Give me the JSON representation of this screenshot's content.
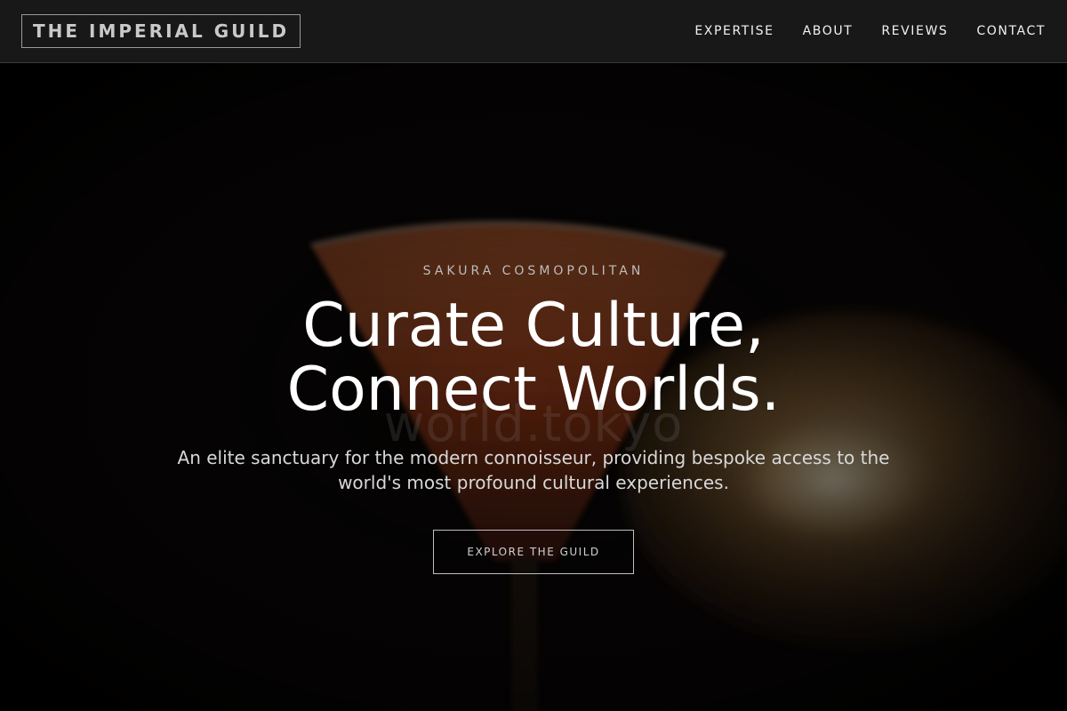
{
  "header": {
    "logo": "THE IMPERIAL GUILD",
    "nav": [
      "EXPERTISE",
      "ABOUT",
      "REVIEWS",
      "CONTACT"
    ]
  },
  "hero": {
    "eyebrow": "SAKURA COSMOPOLITAN",
    "headline_line1": "Curate Culture,",
    "headline_line2": "Connect Worlds.",
    "watermark": "world.tokyo",
    "subtitle": "An elite sanctuary for the modern connoisseur, providing bespoke access to the world's most profound cultural experiences.",
    "cta": "EXPLORE THE GUILD"
  },
  "colors": {
    "header_bg": "#181818",
    "hero_bg": "#030303",
    "drink": "#8a3a1c",
    "candle_glow": "#c9a86a"
  }
}
